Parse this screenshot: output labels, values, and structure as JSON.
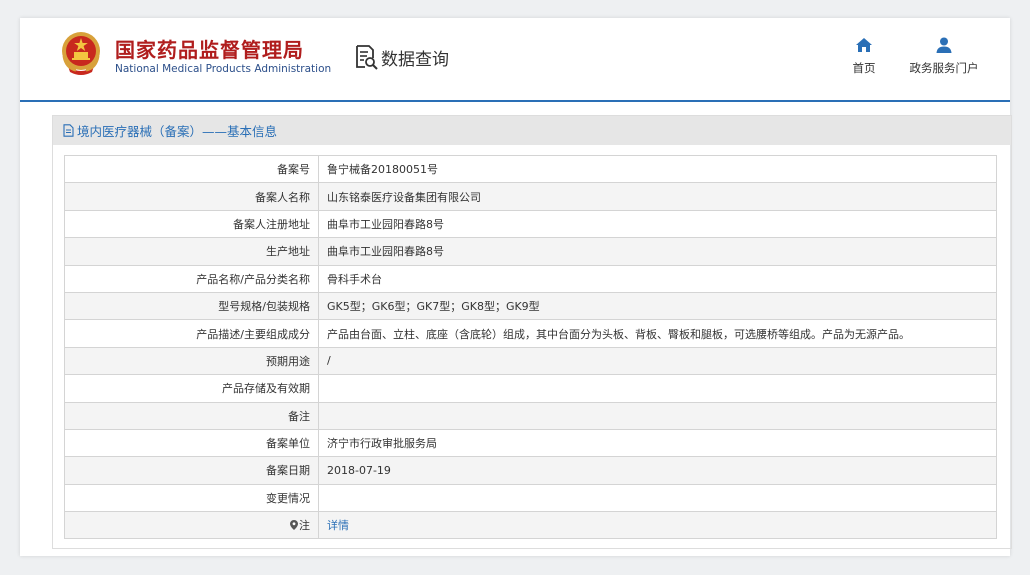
{
  "header": {
    "org_name_cn": "国家药品监督管理局",
    "org_name_en": "National Medical Products Administration",
    "data_query_label": "数据查询",
    "nav": {
      "home_label": "首页",
      "portal_label": "政务服务门户"
    }
  },
  "section": {
    "title": "境内医疗器械（备案）——基本信息"
  },
  "record": {
    "rows": [
      {
        "label": "备案号",
        "value": "鲁宁械备20180051号"
      },
      {
        "label": "备案人名称",
        "value": "山东铭泰医疗设备集团有限公司"
      },
      {
        "label": "备案人注册地址",
        "value": "曲阜市工业园阳春路8号"
      },
      {
        "label": "生产地址",
        "value": "曲阜市工业园阳春路8号"
      },
      {
        "label": "产品名称/产品分类名称",
        "value": "骨科手术台"
      },
      {
        "label": "型号规格/包装规格",
        "value": "GK5型；GK6型；GK7型；GK8型；GK9型"
      },
      {
        "label": "产品描述/主要组成成分",
        "value": "产品由台面、立柱、底座（含底轮）组成，其中台面分为头板、背板、臀板和腿板，可选腰桥等组成。产品为无源产品。"
      },
      {
        "label": "预期用途",
        "value": "/"
      },
      {
        "label": "产品存储及有效期",
        "value": ""
      },
      {
        "label": "备注",
        "value": ""
      },
      {
        "label": "备案单位",
        "value": "济宁市行政审批服务局"
      },
      {
        "label": "备案日期",
        "value": "2018-07-19"
      },
      {
        "label": "变更情况",
        "value": ""
      },
      {
        "label": "注",
        "value": "详情"
      }
    ]
  },
  "icons": {
    "emblem": "national-emblem-icon",
    "data_query": "document-search-icon",
    "home": "home-icon",
    "portal": "user-icon",
    "section": "document-icon",
    "note": "map-pin-icon"
  },
  "colors": {
    "brand_red": "#b01d1d",
    "brand_blue": "#2a6fb6",
    "header_rule": "#2a6fb6"
  }
}
